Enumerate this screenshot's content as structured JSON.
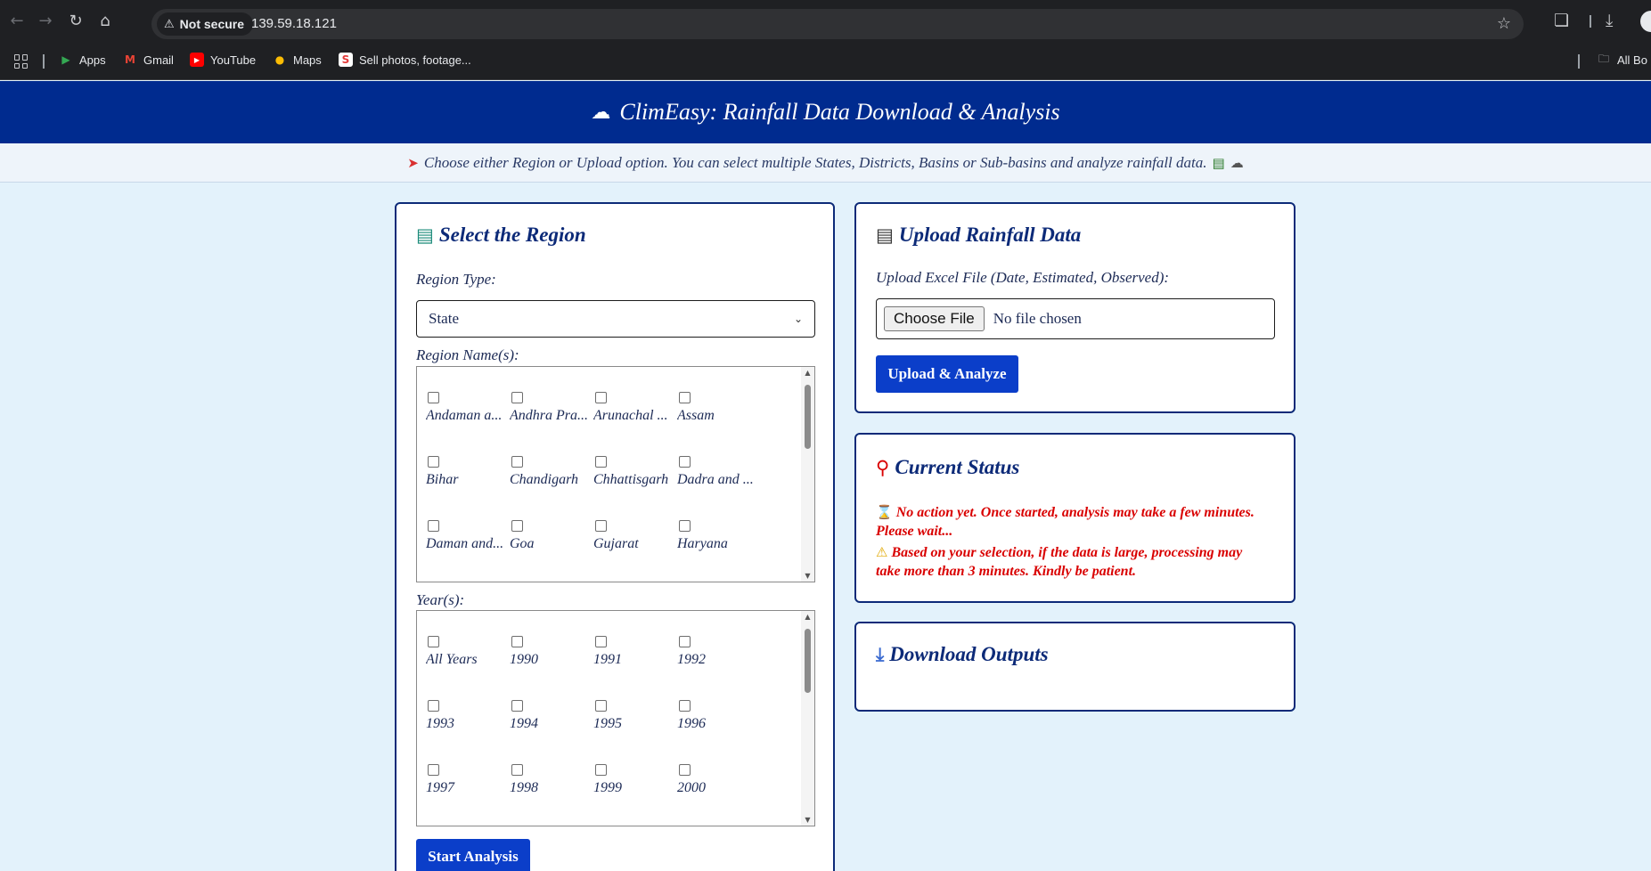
{
  "browser": {
    "security_label": "Not secure",
    "url": "139.59.18.121",
    "bookmarks": [
      {
        "label": "Apps",
        "icon": "play-icon",
        "color": "#34a853"
      },
      {
        "label": "Gmail",
        "icon": "gmail-icon",
        "color": "#ea4335"
      },
      {
        "label": "YouTube",
        "icon": "youtube-icon",
        "color": "#ff0000"
      },
      {
        "label": "Maps",
        "icon": "maps-pin-icon",
        "color": "#fbbc04"
      },
      {
        "label": "Sell photos, footage...",
        "icon": "shutterstock-icon",
        "color": "#e33b3b"
      }
    ],
    "all_bookmarks_label": "All Bo"
  },
  "header": {
    "title": "ClimEasy: Rainfall Data Download & Analysis",
    "icon": "rain-cloud-icon",
    "bg_color": "#002b8f"
  },
  "notice": {
    "text": "Choose either Region or Upload option. You can select multiple States, Districts, Basins or Sub-basins and analyze rainfall data.",
    "lead_icon": "megaphone-icon",
    "trail_icons": [
      "chart-icon",
      "cloud-icon"
    ]
  },
  "region_card": {
    "title": "Select the Region",
    "icon": "map-icon",
    "region_type_label": "Region Type:",
    "region_type_value": "State",
    "region_names_label": "Region Name(s):",
    "region_names": [
      "Andaman a...",
      "Andhra Pra...",
      "Arunachal ...",
      "Assam",
      "Bihar",
      "Chandigarh",
      "Chhattisgarh",
      "Dadra and ...",
      "Daman and...",
      "Goa",
      "Gujarat",
      "Haryana"
    ],
    "years_label": "Year(s):",
    "years": [
      "All Years",
      "1990",
      "1991",
      "1992",
      "1993",
      "1994",
      "1995",
      "1996",
      "1997",
      "1998",
      "1999",
      "2000"
    ],
    "start_button": "Start Analysis"
  },
  "upload_card": {
    "title": "Upload Rainfall Data",
    "icon": "page-icon",
    "file_label": "Upload Excel File (Date, Estimated, Observed):",
    "choose_file": "Choose File",
    "no_file": "No file chosen",
    "upload_button": "Upload & Analyze"
  },
  "status_card": {
    "title": "Current Status",
    "icon": "pushpin-icon",
    "line1": "No action yet. Once started, analysis may take a few minutes. Please wait...",
    "line1_icon": "hourglass-icon",
    "line2": "Based on your selection, if the data is large, processing may take more than 3 minutes. Kindly be patient.",
    "line2_icon": "warning-icon",
    "text_color": "#d90000"
  },
  "download_card": {
    "title": "Download Outputs",
    "icon": "tray-download-icon"
  }
}
